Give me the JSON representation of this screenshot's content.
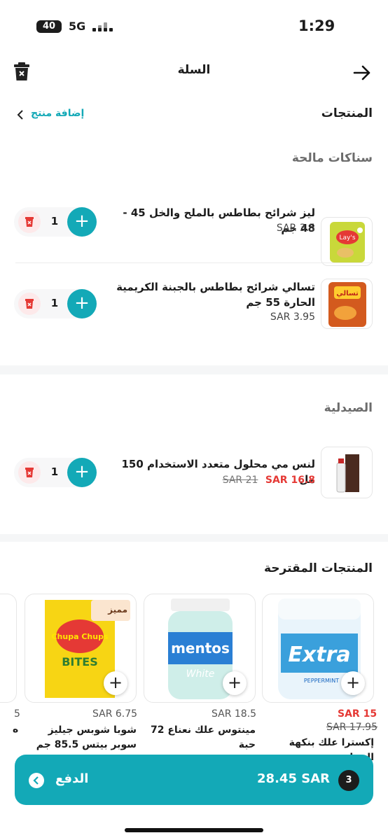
{
  "status_bar": {
    "time": "1:29",
    "network": "5G",
    "battery": "40"
  },
  "header": {
    "title": "السلة"
  },
  "products_section": {
    "title": "المنتجات",
    "add_product": "إضافة منتج"
  },
  "groups": [
    {
      "title": "سناكات مالحة",
      "items": [
        {
          "name": "ليز شرائح بطاطس بالملح والخل 45 - 48 جم",
          "price": "SAR 3.5",
          "qty": "1"
        },
        {
          "name": "تسالي شرائح بطاطس بالجبنة الكريمية الحارة 55 جم",
          "price": "SAR 3.95",
          "qty": "1"
        }
      ]
    },
    {
      "title": "الصيدلية",
      "items": [
        {
          "name": "لنس مي محلول متعدد الاستخدام 150 مل",
          "old_price": "SAR 21",
          "price": "SAR 16.8",
          "qty": "1"
        }
      ]
    }
  ],
  "suggested": {
    "title": "المنتجات المقترحة",
    "items": [
      {
        "name": "إكسترا علك بنكهة النعناع",
        "price": "SAR 15",
        "old_price": "SAR 17.95",
        "image_text": "Extra",
        "image_sub": "PEPPERMINT"
      },
      {
        "name": "مينتوس علك نعناع 72 حبة",
        "price": "SAR 18.5",
        "image_text": "mentos",
        "image_sub": "White"
      },
      {
        "name": "شوبا شوبس جيليز سوبر بيتس 85.5 جم",
        "price": "SAR 6.75",
        "badge": "مميز",
        "image_text": "Chupa Chups",
        "image_sub": "BITES"
      },
      {
        "name": "ه",
        "price": "5"
      }
    ]
  },
  "checkout": {
    "label": "الدفع",
    "total": "28.45 SAR",
    "count": "3"
  },
  "colors": {
    "accent": "#13a9b7",
    "danger": "#e53935",
    "delete_bg": "#fde9ea"
  },
  "images": {
    "lays_text": "Lay's",
    "tasali_text": "تسالي"
  }
}
